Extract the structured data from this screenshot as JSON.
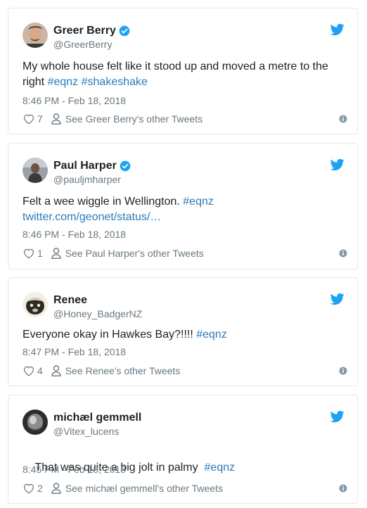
{
  "colors": {
    "link": "#2b7bb9",
    "text": "#1c2022",
    "muted": "#697882",
    "twitter_blue": "#1da1f2",
    "border": "#e1e8ed"
  },
  "icons": {
    "verified": "verified-badge-icon",
    "bird": "twitter-bird-icon",
    "like": "heart-icon",
    "profile": "person-icon",
    "info": "info-icon"
  },
  "tweets": [
    {
      "name": "Greer Berry",
      "verified": true,
      "handle": "@GreerBerry",
      "text_parts": [
        "My whole house felt like it stood up and moved a metre to the right ",
        "#eqnz",
        " ",
        "#shakeshake"
      ],
      "time": "8:46 PM - Feb 18, 2018",
      "likes": "7",
      "other_tweets": "See Greer Berry's other Tweets"
    },
    {
      "name": "Paul Harper",
      "verified": true,
      "handle": "@pauljmharper",
      "text_parts": [
        "Felt a wee wiggle in Wellington. ",
        "#eqnz",
        "twitter.com/geonet/status/…"
      ],
      "time": "8:46 PM - Feb 18, 2018",
      "likes": "1",
      "other_tweets": "See Paul Harper's other Tweets"
    },
    {
      "name": "Renee",
      "verified": false,
      "handle": "@Honey_BadgerNZ",
      "text_parts": [
        "Everyone okay in Hawkes Bay?!!!! ",
        "#eqnz"
      ],
      "time": "8:47 PM - Feb 18, 2018",
      "likes": "4",
      "other_tweets": "See Renee's other Tweets"
    },
    {
      "name": "michæl gemmell",
      "verified": false,
      "handle": "@Vitex_lucens",
      "text_parts": [
        "That was quite a big jolt in palmy  ",
        "#eqnz"
      ],
      "time": "8:45 PM - Feb 18, 2018",
      "likes": "2",
      "other_tweets": "See michæl gemmell's other Tweets"
    }
  ]
}
